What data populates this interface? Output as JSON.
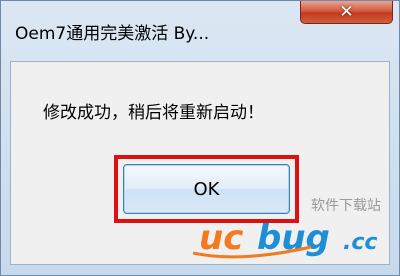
{
  "window": {
    "title": "Oem7通用完美激活 By...",
    "close_glyph": "✕"
  },
  "dialog": {
    "message": "修改成功，稍后将重新启动！",
    "ok_label": "OK"
  },
  "watermark": {
    "text": "软件下载站",
    "logo": "ucbug.cc"
  },
  "colors": {
    "highlight": "#e01010",
    "logo_orange": "#f47a20",
    "logo_blue": "#1e8fd6"
  }
}
